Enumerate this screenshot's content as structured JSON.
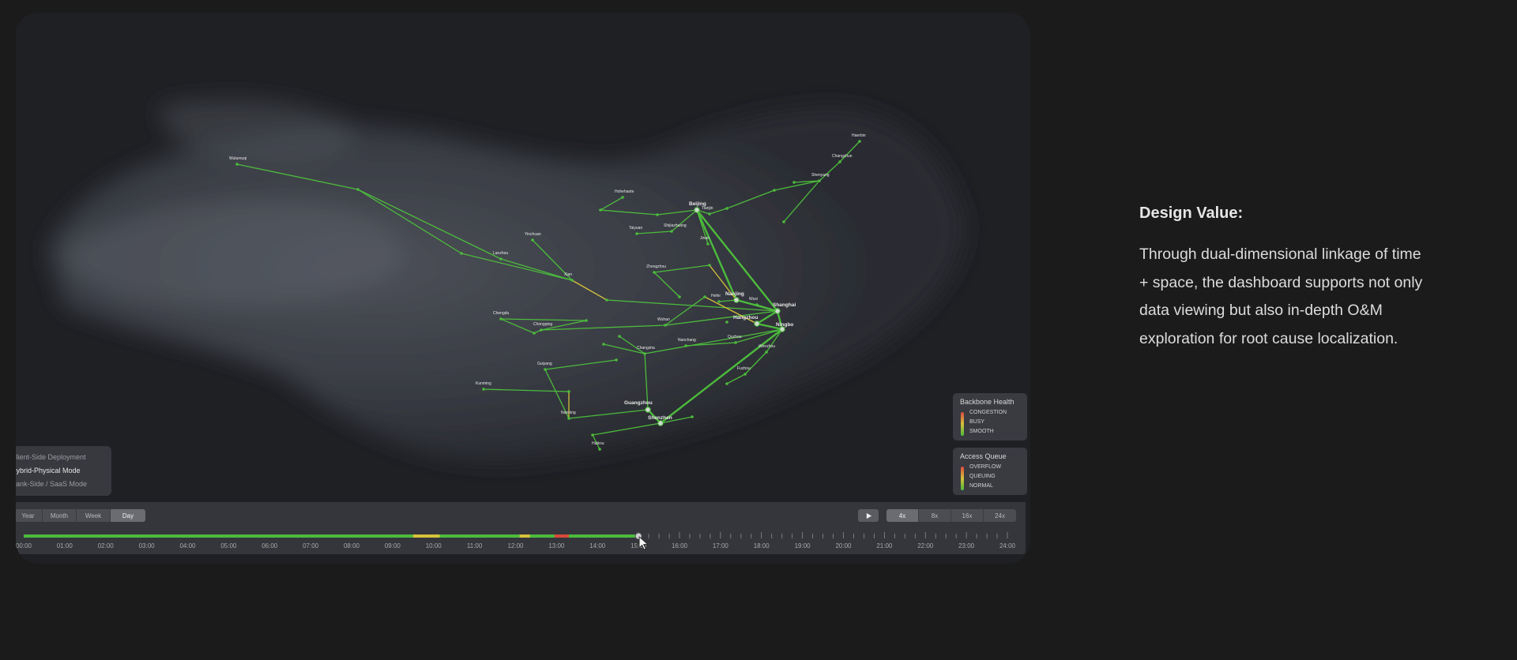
{
  "map": {
    "cities": [
      {
        "name": "Wulumuqi",
        "label": "Wulumuqi"
      },
      {
        "name": "Hohehaote",
        "label": "Hohehaote"
      },
      {
        "name": "Beijing",
        "label": "Beijing"
      },
      {
        "name": "Tianjin",
        "label": "Tianjin"
      },
      {
        "name": "Harbin",
        "label": "Haerbin"
      },
      {
        "name": "Changchun",
        "label": "Changchun"
      },
      {
        "name": "Shenyang",
        "label": "Shenyang"
      },
      {
        "name": "Taiyuan",
        "label": "Taiyuan"
      },
      {
        "name": "Shijiazhuang",
        "label": "Shijiazhuang"
      },
      {
        "name": "Jinan",
        "label": "Jinan"
      },
      {
        "name": "Yinchuan",
        "label": "Yinchuan"
      },
      {
        "name": "Lanzhou",
        "label": "Lanzhou"
      },
      {
        "name": "Xian",
        "label": "Xian"
      },
      {
        "name": "Zhengzhou",
        "label": "Zhengzhou"
      },
      {
        "name": "Nanjing",
        "label": "Nanjing"
      },
      {
        "name": "Hefei",
        "label": "Hefei"
      },
      {
        "name": "Wuxi",
        "label": "Wuxi"
      },
      {
        "name": "Shanghai",
        "label": "Shanghai"
      },
      {
        "name": "Hangzhou",
        "label": "Hangzhou"
      },
      {
        "name": "Ningbo",
        "label": "Ningbo"
      },
      {
        "name": "Chengdu",
        "label": "Chengdu"
      },
      {
        "name": "Chongqing",
        "label": "Chongqing"
      },
      {
        "name": "Wuhan",
        "label": "Wuhan"
      },
      {
        "name": "Changsha",
        "label": "Changsha"
      },
      {
        "name": "Nanchang",
        "label": "Nanchang"
      },
      {
        "name": "Quzhou",
        "label": "Quzhou"
      },
      {
        "name": "Wenzhou",
        "label": "Wenzhou"
      },
      {
        "name": "Fuzhou",
        "label": "Fuzhou"
      },
      {
        "name": "Guiyang",
        "label": "Guiyang"
      },
      {
        "name": "Kunming",
        "label": "Kunming"
      },
      {
        "name": "Nanning",
        "label": "Nanning"
      },
      {
        "name": "Guangzhou",
        "label": "Guangzhou"
      },
      {
        "name": "Shenzhen",
        "label": "Shenzhen"
      },
      {
        "name": "Haikou",
        "label": "Haikou"
      }
    ]
  },
  "deployment_modes": [
    {
      "label": "Client-Side Deployment",
      "active": false
    },
    {
      "label": "Hybrid-Physical Mode",
      "active": true
    },
    {
      "label": "Bank-Side / SaaS Mode",
      "active": false
    }
  ],
  "legends": {
    "backbone": {
      "title": "Backbone Health",
      "items": [
        "CONGESTION",
        "BUSY",
        "SMOOTH"
      ]
    },
    "access": {
      "title": "Access Queue",
      "items": [
        "OVERFLOW",
        "QUEUING",
        "NORMAL"
      ]
    }
  },
  "colors": {
    "smooth": "#4cbb3c",
    "busy": "#d6c23a",
    "congestion": "#d94a3c",
    "accent": "#4cbb3c"
  },
  "timeline": {
    "ranges": [
      {
        "label": "Year",
        "active": false
      },
      {
        "label": "Month",
        "active": false
      },
      {
        "label": "Week",
        "active": false
      },
      {
        "label": "Day",
        "active": true
      }
    ],
    "speeds": [
      {
        "label": "4x",
        "active": true
      },
      {
        "label": "8x",
        "active": false
      },
      {
        "label": "16x",
        "active": false
      },
      {
        "label": "24x",
        "active": false
      }
    ],
    "play_icon": "play-icon",
    "hours": [
      "00:00",
      "01:00",
      "02:00",
      "03:00",
      "04:00",
      "05:00",
      "06:00",
      "07:00",
      "08:00",
      "09:00",
      "10:00",
      "11:00",
      "12:00",
      "13:00",
      "14:00",
      "15:00",
      "16:00",
      "17:00",
      "18:00",
      "19:00",
      "20:00",
      "21:00",
      "22:00",
      "23:00",
      "24:00"
    ],
    "current_hour": 15.0,
    "status_segments": [
      {
        "start": 9.5,
        "end": 10.15,
        "status": "busy"
      },
      {
        "start": 12.1,
        "end": 12.35,
        "status": "busy"
      },
      {
        "start": 12.95,
        "end": 13.3,
        "status": "congestion"
      }
    ]
  },
  "design_value": {
    "title": "Design Value:",
    "body": "Through dual-dimensional linkage of time + space, the dashboard supports not only data viewing but also in-depth O&M exploration for root cause localization."
  }
}
